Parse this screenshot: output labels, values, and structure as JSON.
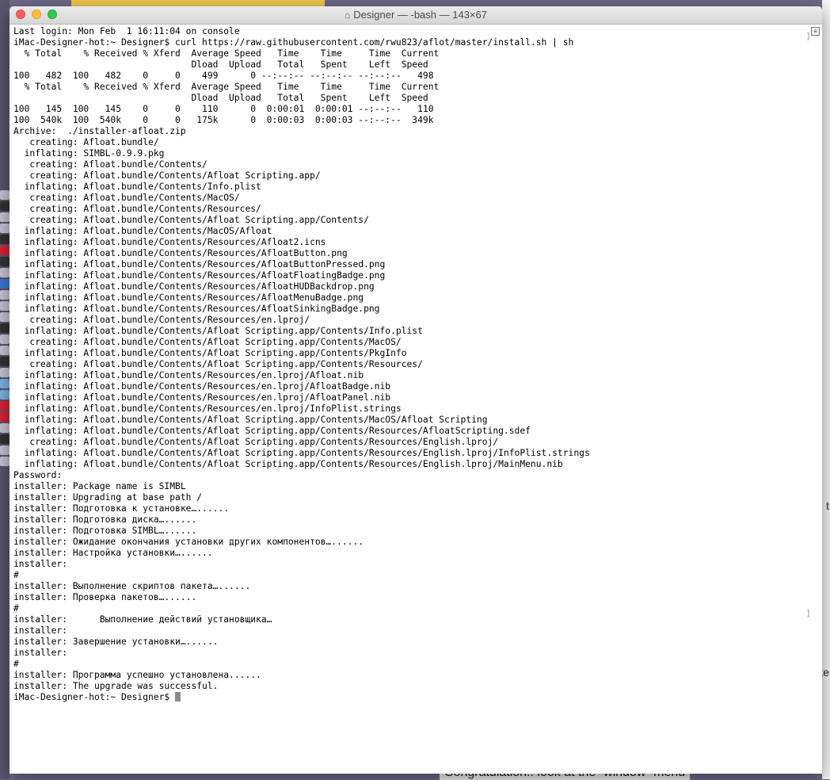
{
  "window": {
    "title": "Designer — -bash — 143×67",
    "home_icon": "home-icon"
  },
  "background": {
    "bottom_text": "Congratulation!! look at the `window` menu",
    "right_text_1": "t",
    "right_text_2": "te"
  },
  "terminal": {
    "lines": [
      "Last login: Mon Feb  1 16:11:04 on console",
      "iMac-Designer-hot:~ Designer$ curl https://raw.githubusercontent.com/rwu823/aflot/master/install.sh | sh",
      "  % Total    % Received % Xferd  Average Speed   Time    Time     Time  Current",
      "                                 Dload  Upload   Total   Spent    Left  Speed",
      "100   482  100   482    0     0    499      0 --:--:-- --:--:-- --:--:--   498",
      "  % Total    % Received % Xferd  Average Speed   Time    Time     Time  Current",
      "                                 Dload  Upload   Total   Spent    Left  Speed",
      "100   145  100   145    0     0    110      0  0:00:01  0:00:01 --:--:--   110",
      "100  540k  100  540k    0     0   175k      0  0:00:03  0:00:03 --:--:--  349k",
      "Archive:  ./installer-afloat.zip",
      "   creating: Afloat.bundle/",
      "  inflating: SIMBL-0.9.9.pkg",
      "   creating: Afloat.bundle/Contents/",
      "   creating: Afloat.bundle/Contents/Afloat Scripting.app/",
      "  inflating: Afloat.bundle/Contents/Info.plist",
      "   creating: Afloat.bundle/Contents/MacOS/",
      "   creating: Afloat.bundle/Contents/Resources/",
      "   creating: Afloat.bundle/Contents/Afloat Scripting.app/Contents/",
      "  inflating: Afloat.bundle/Contents/MacOS/Afloat",
      "  inflating: Afloat.bundle/Contents/Resources/Afloat2.icns",
      "  inflating: Afloat.bundle/Contents/Resources/AfloatButton.png",
      "  inflating: Afloat.bundle/Contents/Resources/AfloatButtonPressed.png",
      "  inflating: Afloat.bundle/Contents/Resources/AfloatFloatingBadge.png",
      "  inflating: Afloat.bundle/Contents/Resources/AfloatHUDBackdrop.png",
      "  inflating: Afloat.bundle/Contents/Resources/AfloatMenuBadge.png",
      "  inflating: Afloat.bundle/Contents/Resources/AfloatSinkingBadge.png",
      "   creating: Afloat.bundle/Contents/Resources/en.lproj/",
      "  inflating: Afloat.bundle/Contents/Afloat Scripting.app/Contents/Info.plist",
      "   creating: Afloat.bundle/Contents/Afloat Scripting.app/Contents/MacOS/",
      "  inflating: Afloat.bundle/Contents/Afloat Scripting.app/Contents/PkgInfo",
      "   creating: Afloat.bundle/Contents/Afloat Scripting.app/Contents/Resources/",
      "  inflating: Afloat.bundle/Contents/Resources/en.lproj/Afloat.nib",
      "  inflating: Afloat.bundle/Contents/Resources/en.lproj/AfloatBadge.nib",
      "  inflating: Afloat.bundle/Contents/Resources/en.lproj/AfloatPanel.nib",
      "  inflating: Afloat.bundle/Contents/Resources/en.lproj/InfoPlist.strings",
      "  inflating: Afloat.bundle/Contents/Afloat Scripting.app/Contents/MacOS/Afloat Scripting",
      "  inflating: Afloat.bundle/Contents/Afloat Scripting.app/Contents/Resources/AfloatScripting.sdef",
      "   creating: Afloat.bundle/Contents/Afloat Scripting.app/Contents/Resources/English.lproj/",
      "  inflating: Afloat.bundle/Contents/Afloat Scripting.app/Contents/Resources/English.lproj/InfoPlist.strings",
      "  inflating: Afloat.bundle/Contents/Afloat Scripting.app/Contents/Resources/English.lproj/MainMenu.nib",
      "Password:",
      "installer: Package name is SIMBL",
      "installer: Upgrading at base path /",
      "installer: Подготовка к установке…......",
      "installer: Подготовка диска…......",
      "installer: Подготовка SIMBL…......",
      "installer: Ожидание окончания установки других компонентов…......",
      "installer: Настройка установки…......",
      "installer:",
      "#",
      "installer: Выполнение скриптов пакета…......",
      "installer: Проверка пакетов…......",
      "#",
      "installer:      Выполнение действий установщика…",
      "installer:",
      "installer: Завершение установки…......",
      "installer:",
      "#",
      "installer: Программа успешно установлена......",
      "installer: The upgrade was successful.",
      "iMac-Designer-hot:~ Designer$ "
    ]
  }
}
